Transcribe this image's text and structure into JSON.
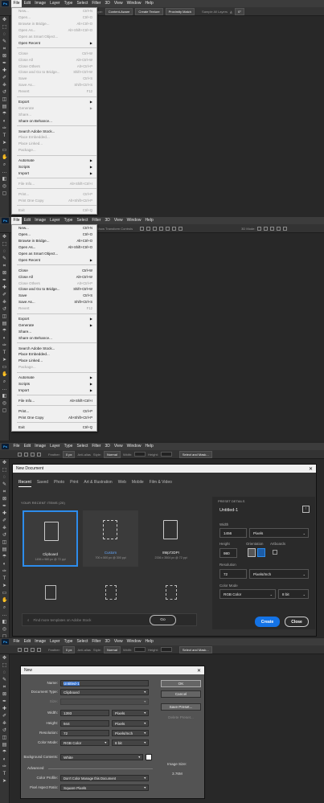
{
  "menubar": {
    "logo": "Ps",
    "items": [
      "File",
      "Edit",
      "Image",
      "Layer",
      "Type",
      "Select",
      "Filter",
      "3D",
      "View",
      "Window",
      "Help"
    ]
  },
  "panel1": {
    "options": {
      "label": "Type:",
      "buttons": [
        "Content-Aware",
        "Create Texture",
        "Proximity Match"
      ],
      "sample": "Sample All Layers",
      "angle": "0°"
    },
    "menu": [
      {
        "t": "New...",
        "s": "Ctrl+N",
        "d": true
      },
      {
        "t": "Open...",
        "s": "Ctrl+O",
        "d": true
      },
      {
        "t": "Browse in Bridge...",
        "s": "Alt+Ctrl+O",
        "d": true
      },
      {
        "t": "Open As...",
        "s": "Alt+Shift+Ctrl+O",
        "d": true
      },
      {
        "t": "Open as Smart Object...",
        "s": "",
        "d": true
      },
      {
        "t": "Open Recent",
        "s": "",
        "sub": true,
        "d": false
      },
      {
        "sep": true
      },
      {
        "t": "Close",
        "s": "Ctrl+W",
        "d": true
      },
      {
        "t": "Close All",
        "s": "Alt+Ctrl+W",
        "d": true
      },
      {
        "t": "Close Others",
        "s": "Alt+Ctrl+P",
        "d": true
      },
      {
        "t": "Close and Go to Bridge...",
        "s": "Shift+Ctrl+W",
        "d": true
      },
      {
        "t": "Save",
        "s": "Ctrl+S",
        "d": true
      },
      {
        "t": "Save As...",
        "s": "Shift+Ctrl+S",
        "d": true
      },
      {
        "t": "Revert",
        "s": "F12",
        "d": true
      },
      {
        "sep": true
      },
      {
        "t": "Export",
        "s": "",
        "sub": true,
        "d": false
      },
      {
        "t": "Generate",
        "s": "",
        "sub": true,
        "d": true
      },
      {
        "t": "Share...",
        "s": "",
        "d": true
      },
      {
        "t": "Share on Behance...",
        "s": "",
        "d": false
      },
      {
        "sep": true
      },
      {
        "t": "Search Adobe Stock...",
        "s": "",
        "d": false
      },
      {
        "t": "Place Embedded...",
        "s": "",
        "d": true
      },
      {
        "t": "Place Linked...",
        "s": "",
        "d": true
      },
      {
        "t": "Package...",
        "s": "",
        "d": true
      },
      {
        "sep": true
      },
      {
        "t": "Automate",
        "s": "",
        "sub": true,
        "d": false
      },
      {
        "t": "Scripts",
        "s": "",
        "sub": true,
        "d": false
      },
      {
        "t": "Import",
        "s": "",
        "sub": true,
        "d": false
      },
      {
        "sep": true
      },
      {
        "t": "File Info...",
        "s": "Alt+Shift+Ctrl+I",
        "d": true
      },
      {
        "sep": true
      },
      {
        "t": "Print...",
        "s": "Ctrl+P",
        "d": true
      },
      {
        "t": "Print One Copy",
        "s": "Alt+Shift+Ctrl+P",
        "d": true
      },
      {
        "sep": true
      },
      {
        "t": "Exit",
        "s": "Ctrl+Q",
        "d": true
      }
    ]
  },
  "panel2": {
    "options": {
      "label": "Show Transform Controls",
      "mode": "3D Mode:"
    },
    "menu": [
      {
        "t": "New...",
        "s": "Ctrl+N",
        "d": false
      },
      {
        "t": "Open...",
        "s": "Ctrl+O",
        "d": false
      },
      {
        "t": "Browse in Bridge...",
        "s": "Alt+Ctrl+O",
        "d": false
      },
      {
        "t": "Open As...",
        "s": "Alt+Shift+Ctrl+O",
        "d": false
      },
      {
        "t": "Open as Smart Object...",
        "s": "",
        "d": false
      },
      {
        "t": "Open Recent",
        "s": "",
        "sub": true,
        "d": false
      },
      {
        "sep": true
      },
      {
        "t": "Close",
        "s": "Ctrl+W",
        "d": false
      },
      {
        "t": "Close All",
        "s": "Alt+Ctrl+W",
        "d": false
      },
      {
        "t": "Close Others",
        "s": "Alt+Ctrl+P",
        "d": true
      },
      {
        "t": "Close and Go to Bridge...",
        "s": "Shift+Ctrl+W",
        "d": false
      },
      {
        "t": "Save",
        "s": "Ctrl+S",
        "d": false
      },
      {
        "t": "Save As...",
        "s": "Shift+Ctrl+S",
        "d": false
      },
      {
        "t": "Revert",
        "s": "F12",
        "d": true
      },
      {
        "sep": true
      },
      {
        "t": "Export",
        "s": "",
        "sub": true,
        "d": false
      },
      {
        "t": "Generate",
        "s": "",
        "sub": true,
        "d": false
      },
      {
        "t": "Share...",
        "s": "",
        "d": false
      },
      {
        "t": "Share on Behance...",
        "s": "",
        "d": false
      },
      {
        "sep": true
      },
      {
        "t": "Search Adobe Stock...",
        "s": "",
        "d": false
      },
      {
        "t": "Place Embedded...",
        "s": "",
        "d": false
      },
      {
        "t": "Place Linked...",
        "s": "",
        "d": false
      },
      {
        "t": "Package...",
        "s": "",
        "d": true
      },
      {
        "sep": true
      },
      {
        "t": "Automate",
        "s": "",
        "sub": true,
        "d": false
      },
      {
        "t": "Scripts",
        "s": "",
        "sub": true,
        "d": false
      },
      {
        "t": "Import",
        "s": "",
        "sub": true,
        "d": false
      },
      {
        "sep": true
      },
      {
        "t": "File Info...",
        "s": "Alt+Shift+Ctrl+I",
        "d": false
      },
      {
        "sep": true
      },
      {
        "t": "Print...",
        "s": "Ctrl+P",
        "d": false
      },
      {
        "t": "Print One Copy",
        "s": "Alt+Shift+Ctrl+P",
        "d": false
      },
      {
        "sep": true
      },
      {
        "t": "Exit",
        "s": "Ctrl+Q",
        "d": false
      }
    ]
  },
  "panel3": {
    "options": {
      "feather": "Feather:",
      "feather_val": "0 px",
      "antialias": "Anti-alias",
      "style": "Style:",
      "style_val": "Normal",
      "width": "Width:",
      "height": "Height:",
      "select": "Select and Mask..."
    },
    "dialog": {
      "title": "New Document",
      "close": "✕",
      "tabs": [
        "Recent",
        "Saved",
        "Photo",
        "Print",
        "Art & Illustration",
        "Web",
        "Mobile",
        "Film & Video"
      ],
      "recent_label": "YOUR RECENT ITEMS",
      "recent_count": "(20)",
      "cards": [
        {
          "name": "Clipboard",
          "desc": "1456 x 980 px @ 72 ppi"
        },
        {
          "name": "Custom",
          "desc": "700 x 500 px @ 300 ppi"
        },
        {
          "name": "8Mp72DPI",
          "desc": "2336 x 3504 px @ 72 ppi"
        }
      ],
      "search_placeholder": "Find more templates on Adobe Stock",
      "go": "Go",
      "preset": {
        "header": "PRESET DETAILS",
        "name": "Untitled-1",
        "width_label": "Width",
        "width": "1456",
        "width_unit": "Pixels",
        "height_label": "Height",
        "height": "980",
        "orientation": "Orientation",
        "artboards": "Artboards",
        "res_label": "Resolution",
        "res": "72",
        "res_unit": "Pixels/Inch",
        "color_label": "Color Mode",
        "color": "RGB Color",
        "bits": "8 bit"
      },
      "create": "Create",
      "close_btn": "Close"
    }
  },
  "panel4": {
    "options": {
      "feather": "Feather:",
      "feather_val": "0 px",
      "antialias": "Anti-alias",
      "style": "Style:",
      "style_val": "Normal",
      "width": "Width:",
      "height": "Height:",
      "select": "Select and Mask..."
    },
    "dialog": {
      "title": "New",
      "close": "✕",
      "name_label": "Name:",
      "name": "Untitled-1",
      "doctype_label": "Document Type:",
      "doctype": "Clipboard",
      "size_label": "Size:",
      "width_label": "Width:",
      "width": "1393",
      "width_unit": "Pixels",
      "height_label": "Height:",
      "height": "944",
      "height_unit": "Pixels",
      "res_label": "Resolution:",
      "res": "72",
      "res_unit": "Pixels/Inch",
      "color_label": "Color Mode:",
      "color": "RGB Color",
      "bits": "8 bit",
      "bg_label": "Background Contents:",
      "bg": "White",
      "advanced": "Advanced",
      "profile_label": "Color Profile:",
      "profile": "Don't Color Manage this Document",
      "aspect_label": "Pixel Aspect Ratio:",
      "aspect": "Square Pixels",
      "ok": "OK",
      "cancel": "Cancel",
      "save_preset": "Save Preset...",
      "delete_preset": "Delete Preset...",
      "image_size_label": "Image Size:",
      "image_size": "3.76M"
    }
  }
}
